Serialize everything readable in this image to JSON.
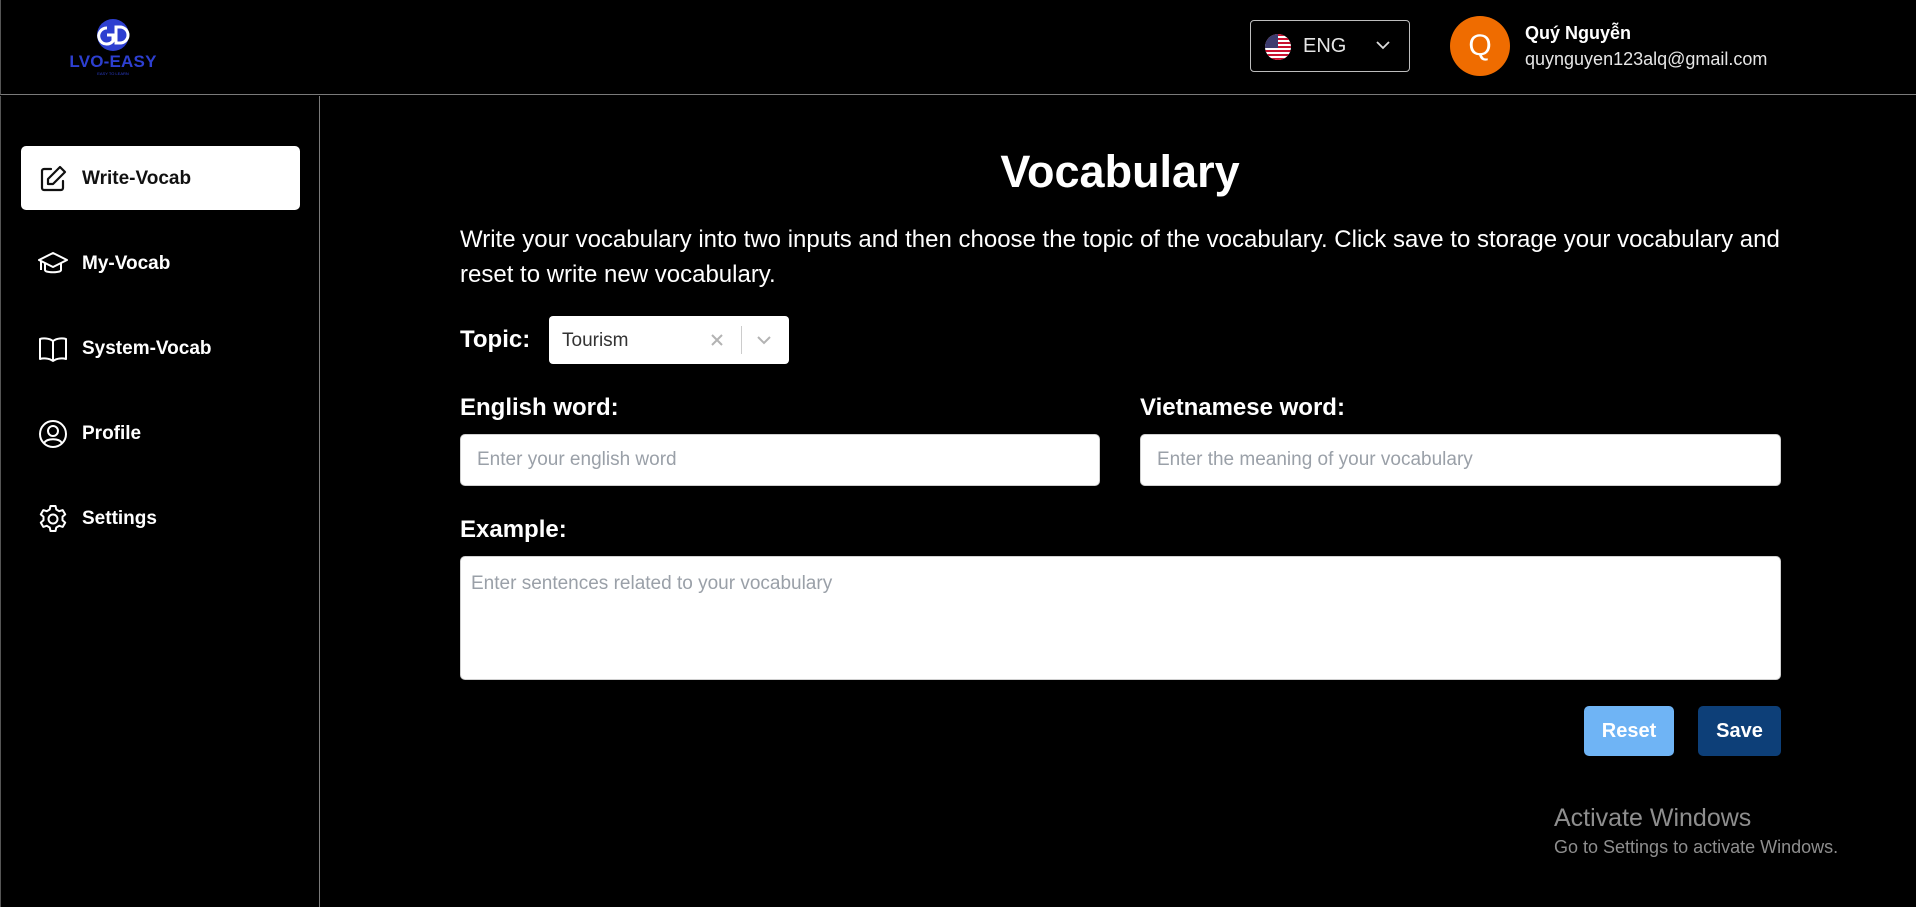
{
  "brand": {
    "name": "LVO-EASY",
    "slogan": "EASY TO LEARN",
    "color": "#2d3fd0"
  },
  "header": {
    "language": {
      "label": "ENG",
      "flag": "us-flag-icon"
    },
    "user": {
      "initial": "Q",
      "name": "Quý Nguyễn",
      "email": "quynguyen123alq@gmail.com",
      "avatar_color": "#ef6c00"
    }
  },
  "sidebar": {
    "items": [
      {
        "label": "Write-Vocab",
        "icon": "edit-icon",
        "active": true
      },
      {
        "label": "My-Vocab",
        "icon": "graduation-cap-icon",
        "active": false
      },
      {
        "label": "System-Vocab",
        "icon": "book-icon",
        "active": false
      },
      {
        "label": "Profile",
        "icon": "user-circle-icon",
        "active": false
      },
      {
        "label": "Settings",
        "icon": "gear-icon",
        "active": false
      }
    ]
  },
  "main": {
    "title": "Vocabulary",
    "description": "Write your vocabulary into two inputs and then choose the topic of the vocabulary. Click save to storage your vocabulary and reset to write new vocabulary.",
    "topic": {
      "label": "Topic:",
      "value": "Tourism"
    },
    "english": {
      "label": "English word:",
      "placeholder": "Enter your english word",
      "value": ""
    },
    "vietnamese": {
      "label": "Vietnamese word:",
      "placeholder": "Enter the meaning of your vocabulary",
      "value": ""
    },
    "example": {
      "label": "Example:",
      "placeholder": "Enter sentences related to your vocabulary",
      "value": ""
    },
    "buttons": {
      "reset": "Reset",
      "save": "Save"
    },
    "colors": {
      "reset": "#6fb4f5",
      "save": "#0d3f78"
    }
  },
  "watermark": {
    "title": "Activate Windows",
    "subtitle": "Go to Settings to activate Windows."
  }
}
